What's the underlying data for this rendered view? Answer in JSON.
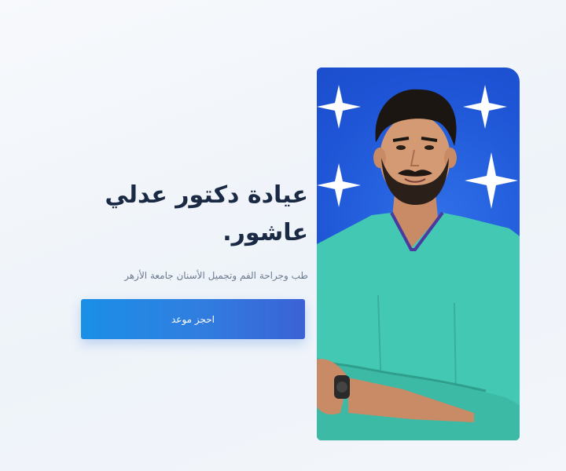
{
  "hero": {
    "title": "عيادة دكتور عدلي عاشور.",
    "subtitle": "طب وجراحة الفم وتجميل الأسنان جامعة الأزهر",
    "cta_label": "احجز موعد"
  },
  "photo": {
    "background_color": "#1e55d6",
    "scrubs_color": "#43c9b3"
  }
}
